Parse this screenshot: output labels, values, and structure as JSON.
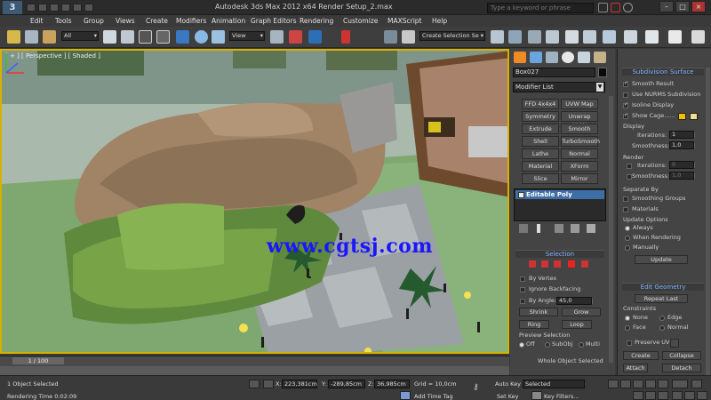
{
  "window": {
    "title": "Autodesk 3ds Max  2012 x64      Render Setup_2.max",
    "search_placeholder": "Type a keyword or phrase",
    "min": "–",
    "max": "□",
    "close": "×"
  },
  "app_logo": "3",
  "menu": [
    "Edit",
    "Tools",
    "Group",
    "Views",
    "Create",
    "Modifiers",
    "Animation",
    "Graph Editors",
    "Rendering",
    "Customize",
    "MAXScript",
    "Help"
  ],
  "toolbar": {
    "selection_filter": "All",
    "ref_coord": "View",
    "selection_set": "Create Selection Se",
    "snap_labels": [
      "3",
      "%",
      "n"
    ]
  },
  "viewport": {
    "label": "[ + ] [ Perspective ] [ Shaded ]",
    "watermark": "www.cgtsj.com",
    "accent": "#d8b000"
  },
  "command_panel": {
    "object_name": "Box027",
    "modifier_list": "Modifier List",
    "modifier_buttons": [
      "FFD 4x4x4",
      "UVW Map",
      "Symmetry",
      "Unwrap UVW",
      "Extrude",
      "Smooth",
      "Shell",
      "TurboSmooth",
      "Lathe",
      "Normal",
      "Material",
      "XForm",
      "Slice",
      "Mirror"
    ],
    "stack_item": "Editable Poly"
  },
  "selection_rollout": {
    "title": "Selection",
    "by_vertex": "By Vertex",
    "ignore_backfacing": "Ignore Backfacing",
    "by_angle": "By Angle:",
    "angle_value": "45,0",
    "shrink": "Shrink",
    "grow": "Grow",
    "ring": "Ring",
    "loop": "Loop",
    "preview_title": "Preview Selection",
    "preview_off": "Off",
    "preview_subobj": "SubObj",
    "preview_multi": "Multi",
    "status": "Whole Object Selected"
  },
  "subdivision": {
    "title": "Subdivision Surface",
    "smooth_result": "Smooth Result",
    "use_nurms": "Use NURMS Subdivision",
    "isoline": "Isoline Display",
    "show_cage": "Show Cage......",
    "display": "Display",
    "iterations_label": "Iterations:",
    "iterations_value": "1",
    "smoothness_label": "Smoothness:",
    "smoothness_value": "1,0",
    "render": "Render",
    "r_iterations_value": "0",
    "r_smoothness_value": "1,0",
    "separate_by": "Separate By",
    "smoothing_groups": "Smoothing Groups",
    "materials": "Materials",
    "update_options": "Update Options",
    "always": "Always",
    "when_rendering": "When Rendering",
    "manually": "Manually",
    "update": "Update",
    "cage_color1": "#f0c000",
    "cage_color2": "#f0e090"
  },
  "edit_geometry": {
    "title": "Edit Geometry",
    "repeat_last": "Repeat Last",
    "constraints": "Constraints",
    "none": "None",
    "edge": "Edge",
    "face": "Face",
    "normal": "Normal",
    "preserve_uvs": "Preserve UVs",
    "create": "Create",
    "collapse": "Collapse",
    "attach": "Attach",
    "detach": "Detach"
  },
  "timeline": {
    "slider": "1 / 100"
  },
  "status": {
    "objects": "1 Object Selected",
    "render_time": "Rendering Time  0:02:09",
    "x_label": "X:",
    "x": "223,381cm",
    "y_label": "Y:",
    "y": "-289,85cm",
    "z_label": "Z:",
    "z": "36,985cm",
    "grid": "Grid = 10,0cm",
    "add_time_tag": "Add Time Tag",
    "auto_key": "Auto Key",
    "set_key": "Set Key",
    "selected": "Selected",
    "key_filters": "Key Filters..."
  }
}
